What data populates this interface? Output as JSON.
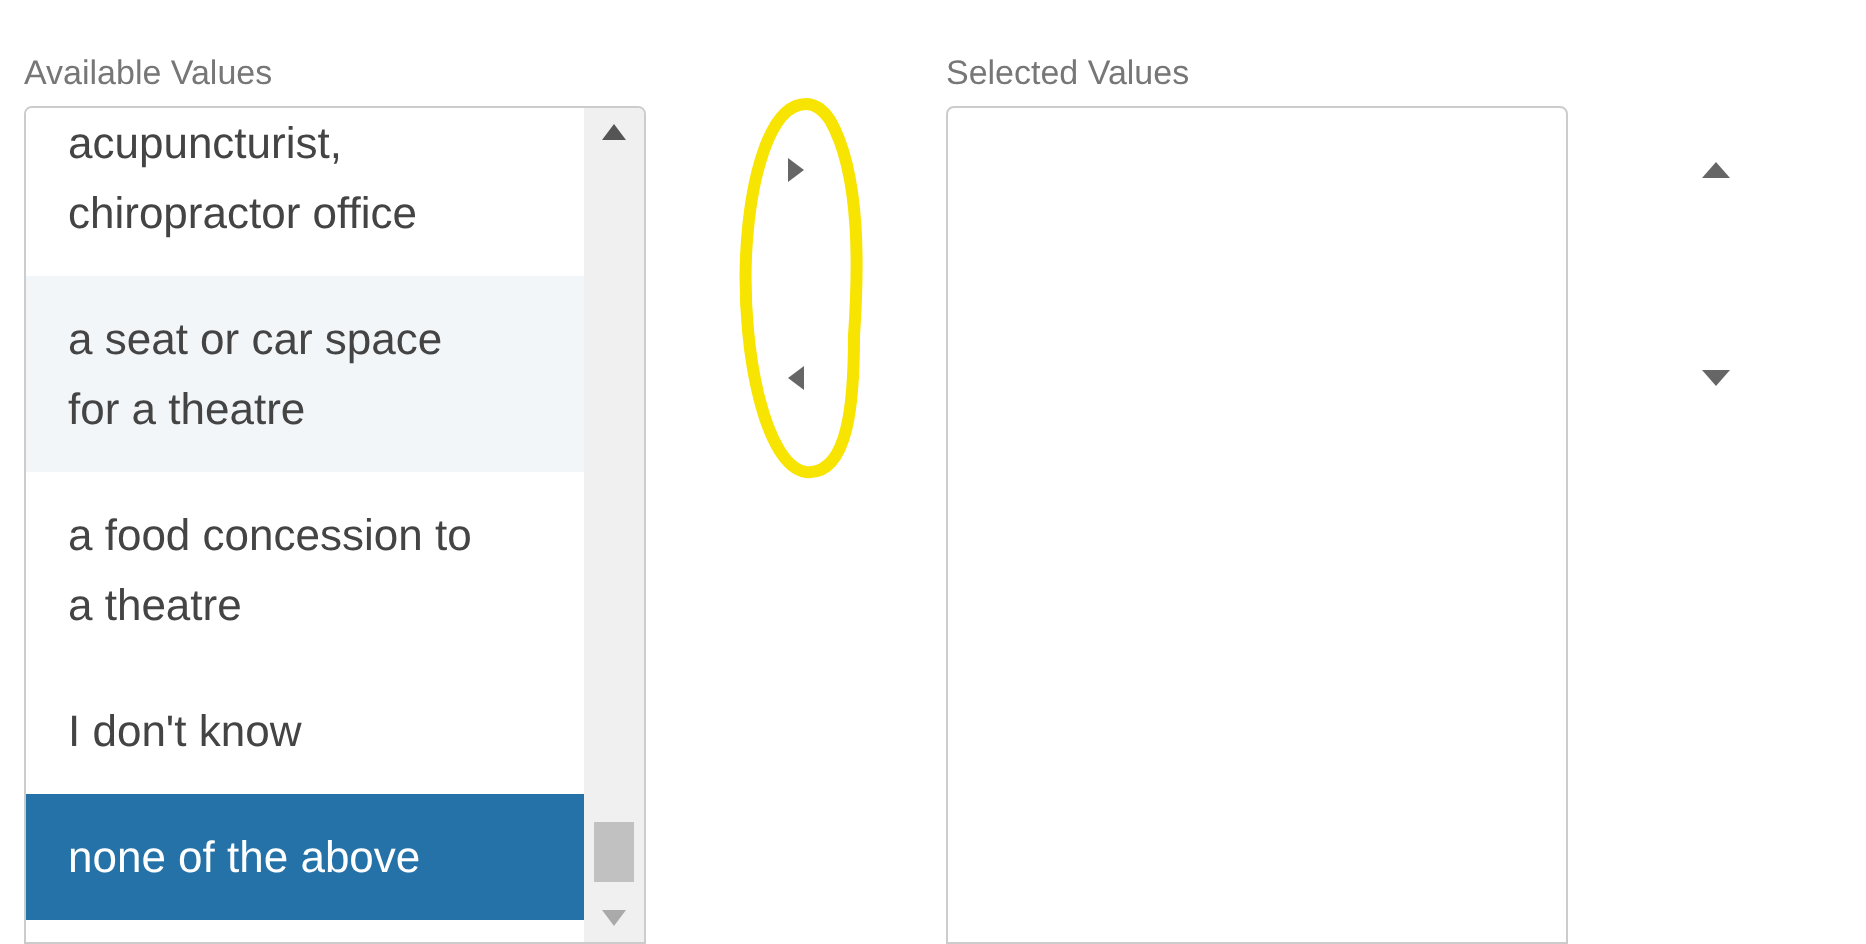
{
  "available": {
    "label": "Available Values",
    "items": [
      {
        "text": "acupuncturist, chiropractor office",
        "selected": false,
        "hovered": false
      },
      {
        "text": "a seat or car space for a theatre",
        "selected": false,
        "hovered": true
      },
      {
        "text": "a food concession to a theatre",
        "selected": false,
        "hovered": false
      },
      {
        "text": "I don't know",
        "selected": false,
        "hovered": false
      },
      {
        "text": "none of the above",
        "selected": true,
        "hovered": false
      }
    ]
  },
  "selected_list": {
    "label": "Selected Values"
  }
}
